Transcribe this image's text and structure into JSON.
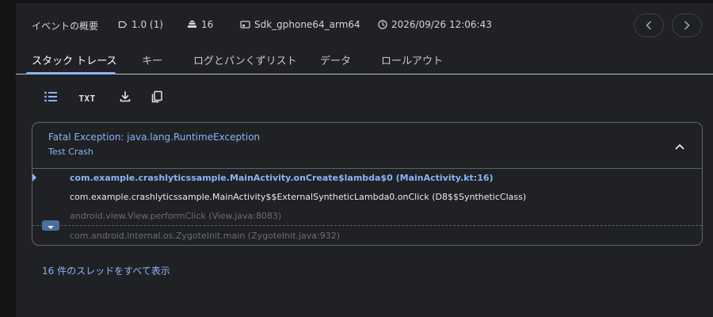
{
  "header": {
    "title": "イベントの概要",
    "version": "1.0 (1)",
    "count": "16",
    "device": "Sdk_gphone64_arm64",
    "timestamp": "2026/09/26 12:06:43"
  },
  "tabs": [
    {
      "label": "スタック トレース",
      "active": true
    },
    {
      "label": "キー",
      "active": false
    },
    {
      "label": "ログとパンくずリスト",
      "active": false
    },
    {
      "label": "データ",
      "active": false
    },
    {
      "label": "ロールアウト",
      "active": false
    }
  ],
  "toolbar": {
    "txt_label": "TXT"
  },
  "exception": {
    "title": "Fatal Exception: java.lang.RuntimeException",
    "message": "Test Crash",
    "frames": [
      "com.example.crashlyticssample.MainActivity.onCreate$lambda$0 (MainActivity.kt:16)",
      "com.example.crashlyticssample.MainActivity$$ExternalSyntheticLambda0.onClick (D8$$SyntheticClass)",
      "android.view.View.performClick (View.java:8083)",
      "com.android.internal.os.ZygoteInit.main (ZygoteInit.java:932)"
    ]
  },
  "threads_link": "16 件のスレッドをすべて表示",
  "colors": {
    "accent": "#8ab4f8",
    "background": "#202124",
    "border": "#5f6368"
  }
}
